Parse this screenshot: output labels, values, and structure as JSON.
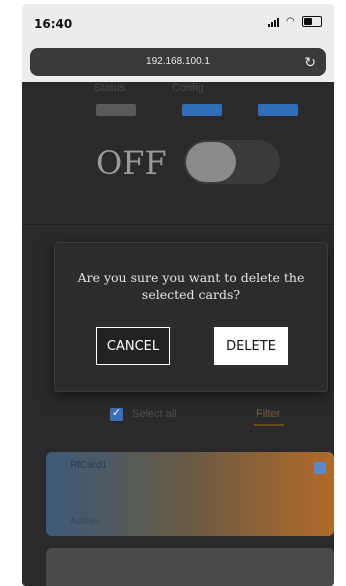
{
  "status_bar": {
    "time": "16:40"
  },
  "browser": {
    "url": "192.168.100.1"
  },
  "nav": {
    "items": [
      {
        "label": "Status",
        "bar_color": "#5a5a5c"
      },
      {
        "label": "Config",
        "bar_color": "#2f6fb8"
      },
      {
        "label": "",
        "bar_color": "#2f6fb8"
      }
    ]
  },
  "power": {
    "label": "OFF",
    "is_on": false
  },
  "dialog": {
    "message": "Are you sure you want to delete the selected cards?",
    "cancel_label": "CANCEL",
    "delete_label": "DELETE"
  },
  "selection": {
    "select_all_label": "Select all",
    "filter_label": "Filter",
    "checked": true
  },
  "cards": [
    {
      "top_label": "RfCard1",
      "value": "",
      "bottom_label": "Admin"
    }
  ],
  "colors": {
    "accent": "#2f6fb8",
    "dialog_bg": "#2e2c2a",
    "page_bg": "#2a2a2c"
  }
}
